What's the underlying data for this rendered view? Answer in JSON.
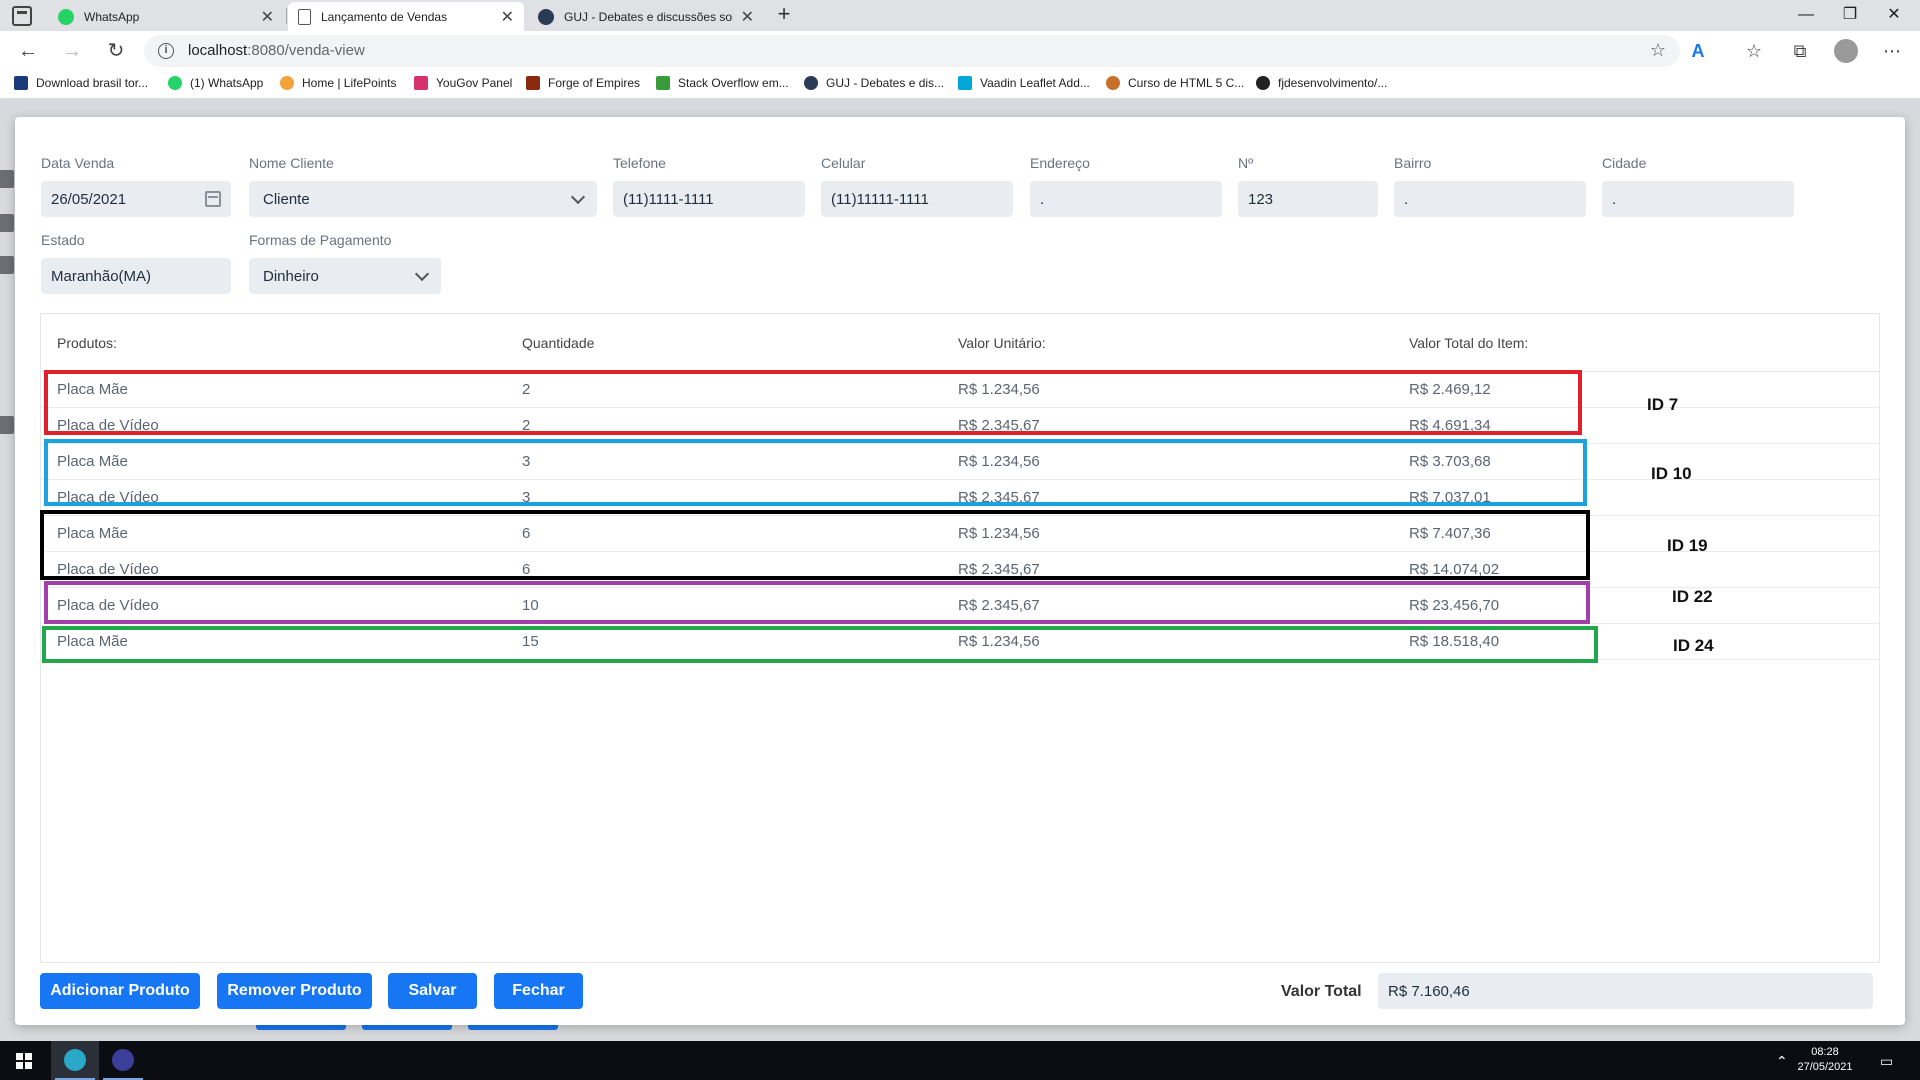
{
  "browser": {
    "tabs": [
      {
        "title": "WhatsApp",
        "favicon_color": "#25d366"
      },
      {
        "title": "Lançamento de Vendas",
        "favicon_color": "#ffffff"
      },
      {
        "title": "GUJ - Debates e discussões sobre",
        "favicon_color": "#2b3a55"
      }
    ],
    "url_host": "localhost",
    "url_path": ":8080/venda-view",
    "bookmarks": [
      {
        "label": "Download brasil tor...",
        "color": "#1a3b7a"
      },
      {
        "label": "(1) WhatsApp",
        "color": "#25d366"
      },
      {
        "label": "Home | LifePoints",
        "color": "#f2a33a"
      },
      {
        "label": "YouGov Panel",
        "color": "#d6336c"
      },
      {
        "label": "Forge of Empires",
        "color": "#8a2b10"
      },
      {
        "label": "Stack Overflow em...",
        "color": "#3a9b3a"
      },
      {
        "label": "GUJ - Debates e dis...",
        "color": "#2b3a55"
      },
      {
        "label": "Vaadin Leaflet Add...",
        "color": "#00a6d6"
      },
      {
        "label": "Curso de HTML 5 C...",
        "color": "#c8702a"
      },
      {
        "label": "fjdesenvolvimento/...",
        "color": "#222222"
      }
    ]
  },
  "form": {
    "data_venda": {
      "label": "Data Venda",
      "value": "26/05/2021"
    },
    "nome_cliente": {
      "label": "Nome Cliente",
      "value": "Cliente"
    },
    "telefone": {
      "label": "Telefone",
      "value": "(11)1111-1111"
    },
    "celular": {
      "label": "Celular",
      "value": "(11)11111-1111"
    },
    "endereco": {
      "label": "Endereço",
      "value": "."
    },
    "numero": {
      "label": "Nº",
      "value": "123"
    },
    "bairro": {
      "label": "Bairro",
      "value": "."
    },
    "cidade": {
      "label": "Cidade",
      "value": "."
    },
    "estado": {
      "label": "Estado",
      "value": "Maranhão(MA)"
    },
    "pagamento": {
      "label": "Formas de Pagamento",
      "value": "Dinheiro"
    }
  },
  "grid": {
    "headers": [
      "Produtos:",
      "Quantidade",
      "Valor Unitário:",
      "Valor Total do Item:"
    ],
    "rows": [
      {
        "produto": "Placa Mãe",
        "quantidade": "2",
        "unitario": "R$ 1.234,56",
        "total": "R$ 2.469,12"
      },
      {
        "produto": "Placa de Vídeo",
        "quantidade": "2",
        "unitario": "R$ 2.345,67",
        "total": "R$ 4.691,34"
      },
      {
        "produto": "Placa Mãe",
        "quantidade": "3",
        "unitario": "R$ 1.234,56",
        "total": "R$ 3.703,68"
      },
      {
        "produto": "Placa de Vídeo",
        "quantidade": "3",
        "unitario": "R$ 2.345,67",
        "total": "R$ 7.037,01"
      },
      {
        "produto": "Placa Mãe",
        "quantidade": "6",
        "unitario": "R$ 1.234,56",
        "total": "R$ 7.407,36"
      },
      {
        "produto": "Placa de Vídeo",
        "quantidade": "6",
        "unitario": "R$ 2.345,67",
        "total": "R$ 14.074,02"
      },
      {
        "produto": "Placa de Vídeo",
        "quantidade": "10",
        "unitario": "R$ 2.345,67",
        "total": "R$ 23.456,70"
      },
      {
        "produto": "Placa Mãe",
        "quantidade": "15",
        "unitario": "R$ 1.234,56",
        "total": "R$ 18.518,40"
      }
    ]
  },
  "annotations": [
    {
      "label": "ID 7",
      "color": "#e0202a"
    },
    {
      "label": "ID 10",
      "color": "#1aa3e0"
    },
    {
      "label": "ID 19",
      "color": "#000000"
    },
    {
      "label": "ID 22",
      "color": "#a040a8"
    },
    {
      "label": "ID 24",
      "color": "#22a84a"
    }
  ],
  "buttons": {
    "adicionar": "Adicionar Produto",
    "remover": "Remover Produto",
    "salvar": "Salvar",
    "fechar": "Fechar"
  },
  "total": {
    "label": "Valor Total",
    "value": "R$ 7.160,46"
  },
  "taskbar": {
    "time": "08:28",
    "date": "27/05/2021"
  },
  "colors": {
    "primary": "#1676f3",
    "field_bg": "#e9ecf0"
  }
}
